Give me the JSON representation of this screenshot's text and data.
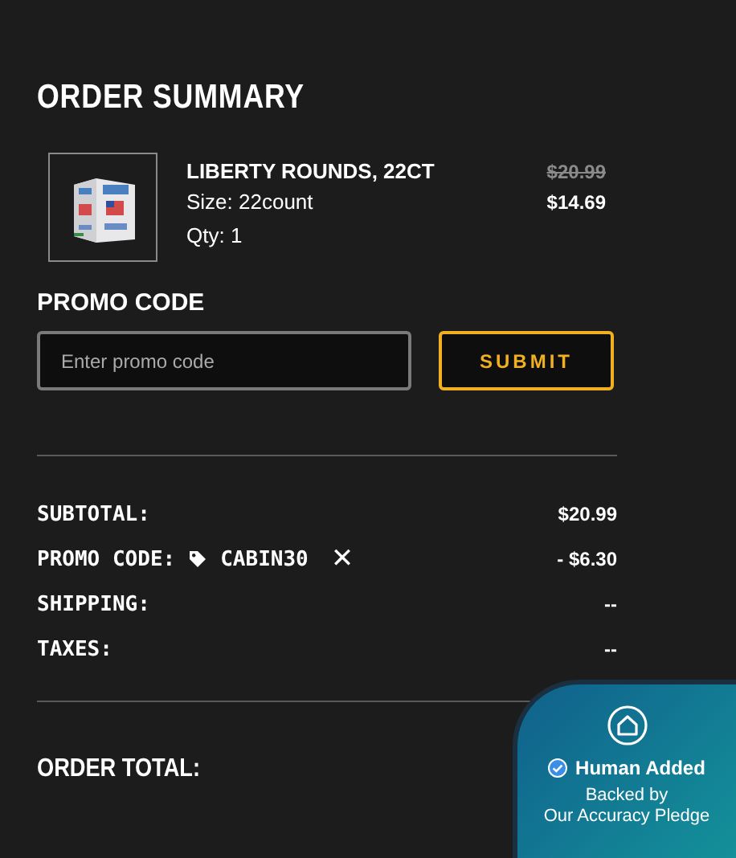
{
  "title": "ORDER SUMMARY",
  "item": {
    "kind": "picture",
    "name": "LIBERTY ROUNDS, 22CT",
    "size": "Size: 22count",
    "qty": "Qty: 1",
    "original_price": "$20.99",
    "price": "$14.69"
  },
  "promo": {
    "label": "PROMO CODE",
    "placeholder": "Enter promo code",
    "button": "SUBMIT"
  },
  "summary": [
    {
      "kind": "plain",
      "label": "SUBTOTAL:",
      "value": "$20.99"
    },
    {
      "kind": "promo",
      "label": "PROMO CODE:",
      "code": "CABIN30",
      "remove": "✕",
      "value": "- $6.30"
    },
    {
      "kind": "plain",
      "label": "SHIPPING:",
      "value": "--"
    },
    {
      "kind": "plain",
      "label": "TAXES:",
      "value": "--"
    }
  ],
  "total": {
    "label": "ORDER TOTAL:"
  },
  "badge": {
    "title": "Human Added",
    "subtitle": "Backed by",
    "pledge": "Our Accuracy Pledge"
  }
}
